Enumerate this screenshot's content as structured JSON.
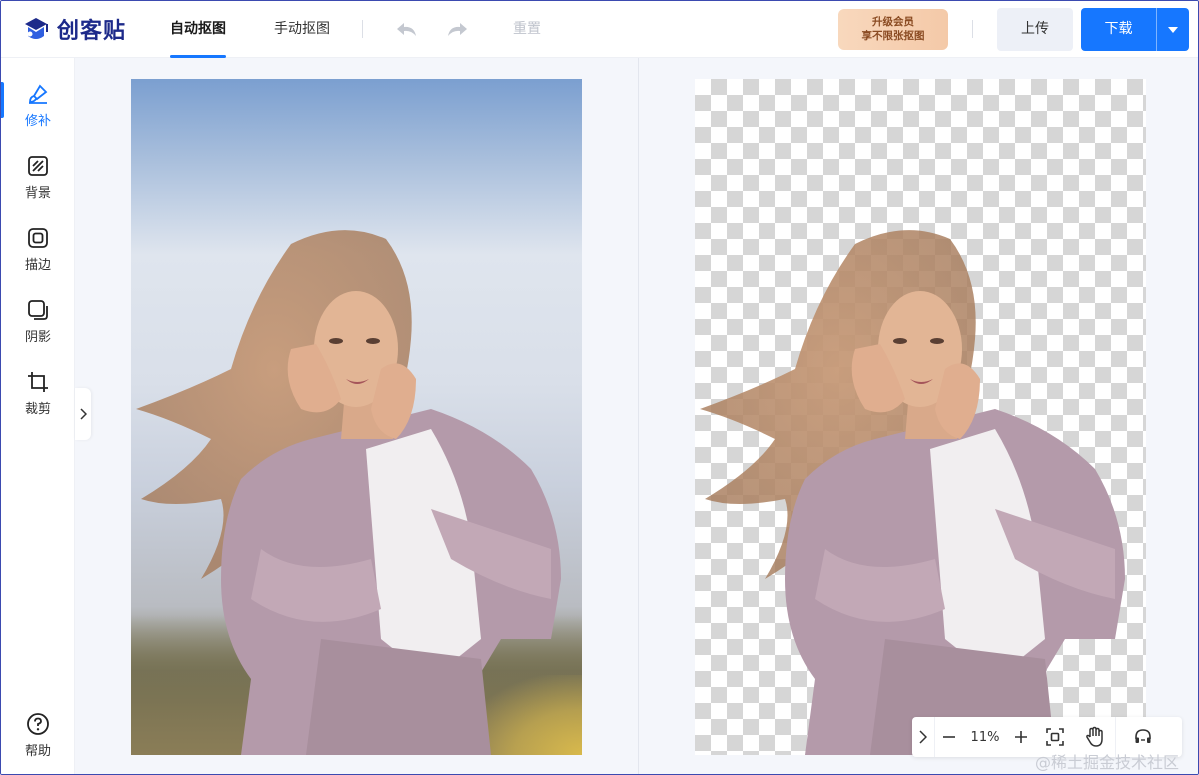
{
  "app": {
    "logo_text": "创客贴"
  },
  "header": {
    "tabs": [
      {
        "label": "自动抠图",
        "active": true
      },
      {
        "label": "手动抠图",
        "active": false
      }
    ],
    "reset_label": "重置",
    "upgrade": {
      "line1": "升级会员",
      "line2": "享不限张抠图"
    },
    "upload_label": "上传",
    "download_label": "下载"
  },
  "sidebar": {
    "items": [
      {
        "label": "修补",
        "icon": "brush-icon",
        "active": true
      },
      {
        "label": "背景",
        "icon": "background-icon",
        "active": false
      },
      {
        "label": "描边",
        "icon": "outline-icon",
        "active": false
      },
      {
        "label": "阴影",
        "icon": "shadow-icon",
        "active": false
      },
      {
        "label": "裁剪",
        "icon": "crop-icon",
        "active": false
      }
    ],
    "help_label": "帮助"
  },
  "zoom": {
    "value": "11%"
  },
  "watermark": "@稀土掘金技术社区",
  "colors": {
    "accent": "#1677ff",
    "brand": "#1d2a8a",
    "upgrade_bg": "#f6d2b4",
    "upgrade_text": "#8a4b22",
    "canvas_bg": "#f4f6fb"
  }
}
